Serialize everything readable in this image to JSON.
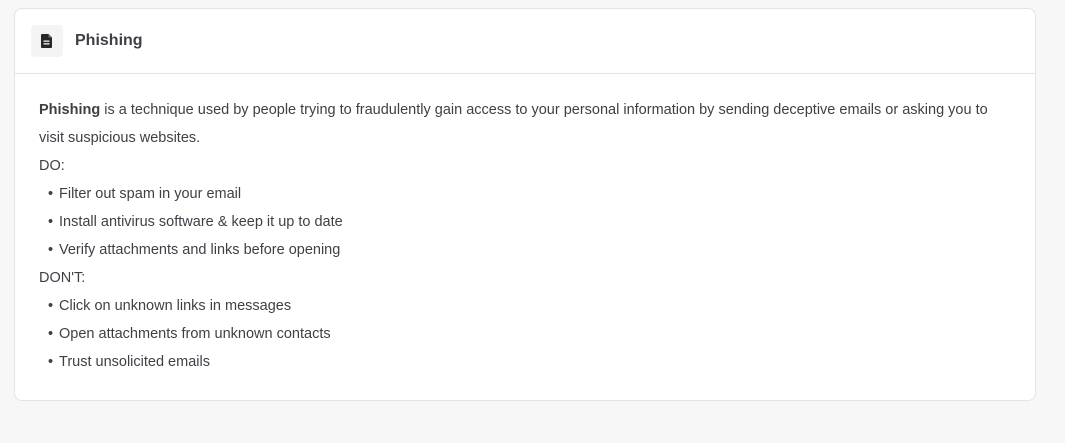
{
  "card": {
    "title": "Phishing",
    "icon": "document-icon"
  },
  "intro": {
    "term": "Phishing",
    "text": " is a technique used by people trying to fraudulently gain access to your personal information by sending deceptive emails or asking you to visit suspicious websites."
  },
  "do_section": {
    "label": "DO:",
    "items": [
      "Filter out spam in your email",
      "Install antivirus software & keep it up to date",
      "Verify attachments and links before opening"
    ]
  },
  "dont_section": {
    "label": "DON'T:",
    "items": [
      "Click on unknown links in messages",
      "Open attachments from unknown contacts",
      "Trust unsolicited emails"
    ]
  },
  "colors": {
    "background": "#f7f7f8",
    "card": "#ffffff",
    "border": "#e4e4e7",
    "text": "#3f3f46"
  }
}
